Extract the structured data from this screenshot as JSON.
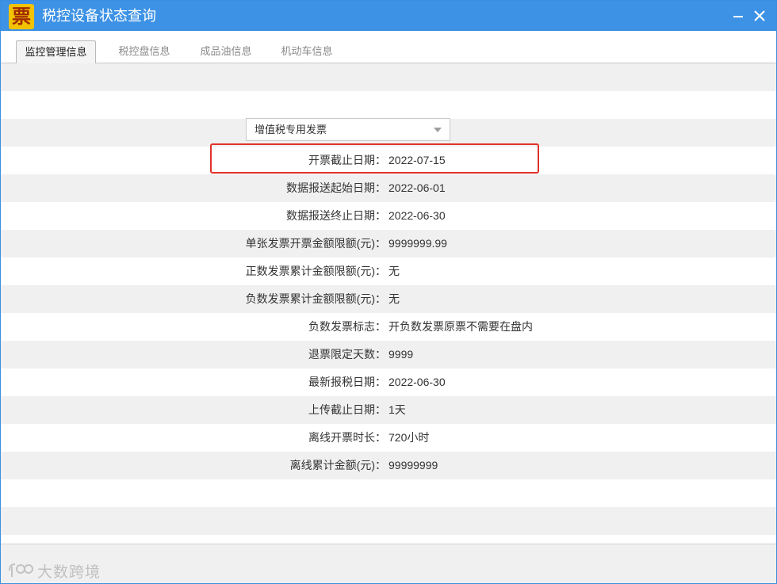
{
  "window": {
    "title": "税控设备状态查询",
    "app_icon_char": "票",
    "title_color": "#3d92e5"
  },
  "tabs": [
    {
      "label": "监控管理信息",
      "active": true
    },
    {
      "label": "税控盘信息",
      "active": false
    },
    {
      "label": "成品油信息",
      "active": false
    },
    {
      "label": "机动车信息",
      "active": false
    }
  ],
  "invoice_type_select": {
    "value": "增值税专用发票"
  },
  "fields": [
    {
      "label": "开票截止日期：",
      "value": "2022-07-15"
    },
    {
      "label": "数据报送起始日期：",
      "value": "2022-06-01"
    },
    {
      "label": "数据报送终止日期：",
      "value": "2022-06-30"
    },
    {
      "label": "单张发票开票金额限额(元)：",
      "value": "9999999.99"
    },
    {
      "label": "正数发票累计金额限额(元)：",
      "value": "无"
    },
    {
      "label": "负数发票累计金额限额(元)：",
      "value": "无"
    },
    {
      "label": "负数发票标志：",
      "value": "开负数发票原票不需要在盘内"
    },
    {
      "label": "退票限定天数：",
      "value": "9999"
    },
    {
      "label": "最新报税日期：",
      "value": "2022-06-30"
    },
    {
      "label": "上传截止日期：",
      "value": "1天"
    },
    {
      "label": "离线开票时长：",
      "value": "720小时"
    },
    {
      "label": "离线累计金额(元)：",
      "value": "99999999"
    }
  ],
  "watermark": {
    "text": "大数跨境"
  },
  "colors": {
    "highlight_border": "#e0322b",
    "row_stripe": "#f0f0f0"
  }
}
